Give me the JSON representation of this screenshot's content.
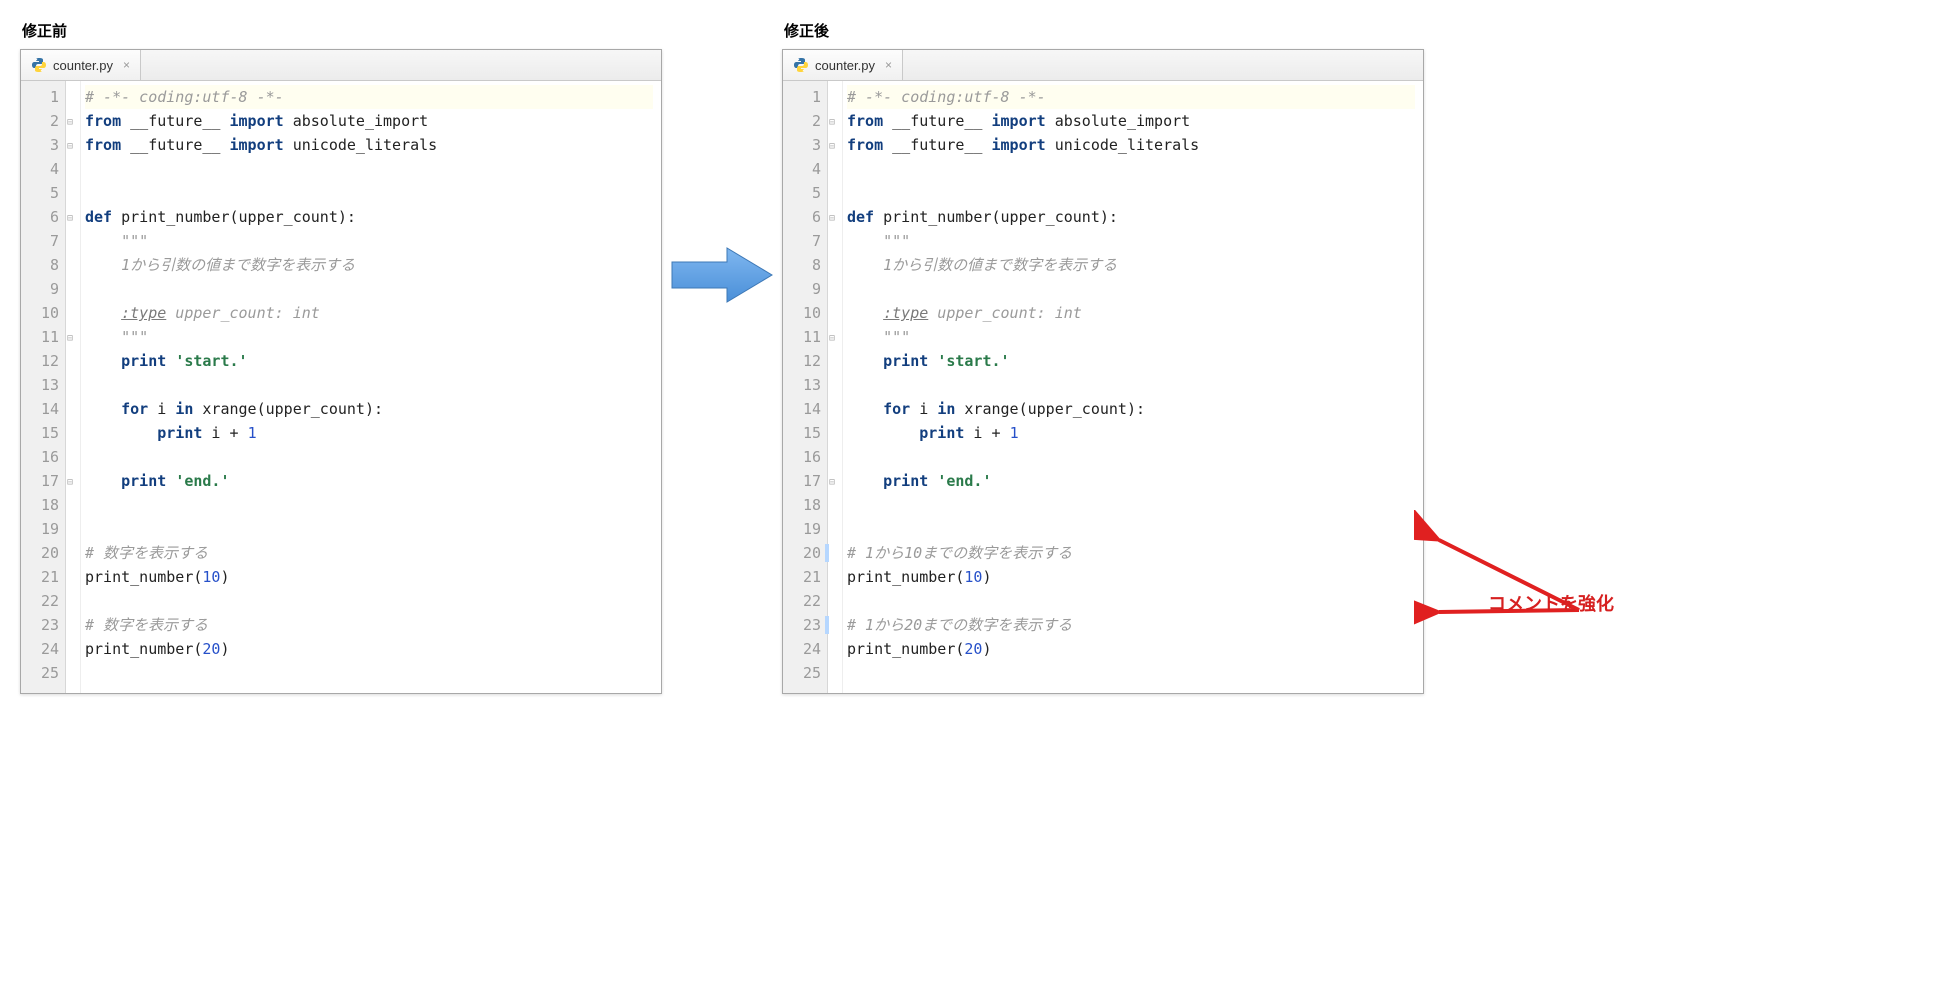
{
  "left": {
    "title": "修正前",
    "tab": {
      "filename": "counter.py"
    },
    "lines": [
      {
        "n": 1,
        "cls": "hl",
        "tokens": [
          [
            "c-comment",
            "# -*- coding:utf-8 -*-"
          ]
        ]
      },
      {
        "n": 2,
        "fold": true,
        "tokens": [
          [
            "c-kw",
            "from"
          ],
          [
            "c-plain",
            " __future__ "
          ],
          [
            "c-kw",
            "import"
          ],
          [
            "c-plain",
            " absolute_import"
          ]
        ]
      },
      {
        "n": 3,
        "fold": true,
        "tokens": [
          [
            "c-kw",
            "from"
          ],
          [
            "c-plain",
            " __future__ "
          ],
          [
            "c-kw",
            "import"
          ],
          [
            "c-plain",
            " unicode_literals"
          ]
        ]
      },
      {
        "n": 4,
        "tokens": []
      },
      {
        "n": 5,
        "tokens": []
      },
      {
        "n": 6,
        "fold": true,
        "tokens": [
          [
            "c-kw",
            "def"
          ],
          [
            "c-plain",
            " "
          ],
          [
            "c-fn",
            "print_number"
          ],
          [
            "c-plain",
            "(upper_count):"
          ]
        ]
      },
      {
        "n": 7,
        "tokens": [
          [
            "c-plain",
            "    "
          ],
          [
            "c-doc",
            "\"\"\""
          ]
        ]
      },
      {
        "n": 8,
        "tokens": [
          [
            "c-plain",
            "    "
          ],
          [
            "c-doc",
            "1から引数の値まで数字を表示する"
          ]
        ]
      },
      {
        "n": 9,
        "tokens": []
      },
      {
        "n": 10,
        "tokens": [
          [
            "c-plain",
            "    "
          ],
          [
            "c-doctag",
            ":type"
          ],
          [
            "c-doc",
            " upper_count: int"
          ]
        ]
      },
      {
        "n": 11,
        "fold": true,
        "tokens": [
          [
            "c-plain",
            "    "
          ],
          [
            "c-doc",
            "\"\"\""
          ]
        ]
      },
      {
        "n": 12,
        "tokens": [
          [
            "c-plain",
            "    "
          ],
          [
            "c-kw",
            "print"
          ],
          [
            "c-plain",
            " "
          ],
          [
            "c-str",
            "'start.'"
          ]
        ]
      },
      {
        "n": 13,
        "tokens": []
      },
      {
        "n": 14,
        "tokens": [
          [
            "c-plain",
            "    "
          ],
          [
            "c-kw",
            "for"
          ],
          [
            "c-plain",
            " i "
          ],
          [
            "c-kw",
            "in"
          ],
          [
            "c-plain",
            " xrange(upper_count):"
          ]
        ]
      },
      {
        "n": 15,
        "tokens": [
          [
            "c-plain",
            "        "
          ],
          [
            "c-kw",
            "print"
          ],
          [
            "c-plain",
            " i "
          ],
          [
            "c-op",
            "+"
          ],
          [
            "c-plain",
            " "
          ],
          [
            "c-num",
            "1"
          ]
        ]
      },
      {
        "n": 16,
        "tokens": []
      },
      {
        "n": 17,
        "fold": true,
        "tokens": [
          [
            "c-plain",
            "    "
          ],
          [
            "c-kw",
            "print"
          ],
          [
            "c-plain",
            " "
          ],
          [
            "c-str",
            "'end.'"
          ]
        ]
      },
      {
        "n": 18,
        "tokens": []
      },
      {
        "n": 19,
        "tokens": []
      },
      {
        "n": 20,
        "tokens": [
          [
            "c-comment",
            "# 数字を表示する"
          ]
        ]
      },
      {
        "n": 21,
        "tokens": [
          [
            "c-plain",
            "print_number("
          ],
          [
            "c-num",
            "10"
          ],
          [
            "c-plain",
            ")"
          ]
        ]
      },
      {
        "n": 22,
        "tokens": []
      },
      {
        "n": 23,
        "tokens": [
          [
            "c-comment",
            "# 数字を表示する"
          ]
        ]
      },
      {
        "n": 24,
        "tokens": [
          [
            "c-plain",
            "print_number("
          ],
          [
            "c-num",
            "20"
          ],
          [
            "c-plain",
            ")"
          ]
        ]
      },
      {
        "n": 25,
        "tokens": []
      }
    ]
  },
  "right": {
    "title": "修正後",
    "tab": {
      "filename": "counter.py"
    },
    "lines": [
      {
        "n": 1,
        "cls": "hl",
        "tokens": [
          [
            "c-comment",
            "# -*- coding:utf-8 -*-"
          ]
        ]
      },
      {
        "n": 2,
        "fold": true,
        "tokens": [
          [
            "c-kw",
            "from"
          ],
          [
            "c-plain",
            " __future__ "
          ],
          [
            "c-kw",
            "import"
          ],
          [
            "c-plain",
            " absolute_import"
          ]
        ]
      },
      {
        "n": 3,
        "fold": true,
        "tokens": [
          [
            "c-kw",
            "from"
          ],
          [
            "c-plain",
            " __future__ "
          ],
          [
            "c-kw",
            "import"
          ],
          [
            "c-plain",
            " unicode_literals"
          ]
        ]
      },
      {
        "n": 4,
        "tokens": []
      },
      {
        "n": 5,
        "tokens": []
      },
      {
        "n": 6,
        "fold": true,
        "tokens": [
          [
            "c-kw",
            "def"
          ],
          [
            "c-plain",
            " "
          ],
          [
            "c-fn",
            "print_number"
          ],
          [
            "c-plain",
            "(upper_count):"
          ]
        ]
      },
      {
        "n": 7,
        "tokens": [
          [
            "c-plain",
            "    "
          ],
          [
            "c-doc",
            "\"\"\""
          ]
        ]
      },
      {
        "n": 8,
        "tokens": [
          [
            "c-plain",
            "    "
          ],
          [
            "c-doc",
            "1から引数の値まで数字を表示する"
          ]
        ]
      },
      {
        "n": 9,
        "tokens": []
      },
      {
        "n": 10,
        "tokens": [
          [
            "c-plain",
            "    "
          ],
          [
            "c-doctag",
            ":type"
          ],
          [
            "c-doc",
            " upper_count: int"
          ]
        ]
      },
      {
        "n": 11,
        "fold": true,
        "tokens": [
          [
            "c-plain",
            "    "
          ],
          [
            "c-doc",
            "\"\"\""
          ]
        ]
      },
      {
        "n": 12,
        "tokens": [
          [
            "c-plain",
            "    "
          ],
          [
            "c-kw",
            "print"
          ],
          [
            "c-plain",
            " "
          ],
          [
            "c-str",
            "'start.'"
          ]
        ]
      },
      {
        "n": 13,
        "tokens": []
      },
      {
        "n": 14,
        "tokens": [
          [
            "c-plain",
            "    "
          ],
          [
            "c-kw",
            "for"
          ],
          [
            "c-plain",
            " i "
          ],
          [
            "c-kw",
            "in"
          ],
          [
            "c-plain",
            " xrange(upper_count):"
          ]
        ]
      },
      {
        "n": 15,
        "tokens": [
          [
            "c-plain",
            "        "
          ],
          [
            "c-kw",
            "print"
          ],
          [
            "c-plain",
            " i "
          ],
          [
            "c-op",
            "+"
          ],
          [
            "c-plain",
            " "
          ],
          [
            "c-num",
            "1"
          ]
        ]
      },
      {
        "n": 16,
        "tokens": []
      },
      {
        "n": 17,
        "fold": true,
        "tokens": [
          [
            "c-plain",
            "    "
          ],
          [
            "c-kw",
            "print"
          ],
          [
            "c-plain",
            " "
          ],
          [
            "c-str",
            "'end.'"
          ]
        ]
      },
      {
        "n": 18,
        "tokens": []
      },
      {
        "n": 19,
        "tokens": []
      },
      {
        "n": 20,
        "mod": true,
        "tokens": [
          [
            "c-comment",
            "# 1から10までの数字を表示する"
          ]
        ]
      },
      {
        "n": 21,
        "tokens": [
          [
            "c-plain",
            "print_number("
          ],
          [
            "c-num",
            "10"
          ],
          [
            "c-plain",
            ")"
          ]
        ]
      },
      {
        "n": 22,
        "tokens": []
      },
      {
        "n": 23,
        "mod": true,
        "tokens": [
          [
            "c-comment",
            "# 1から20までの数字を表示する"
          ]
        ]
      },
      {
        "n": 24,
        "tokens": [
          [
            "c-plain",
            "print_number("
          ],
          [
            "c-num",
            "20"
          ],
          [
            "c-plain",
            ")"
          ]
        ]
      },
      {
        "n": 25,
        "tokens": []
      }
    ]
  },
  "annotation": {
    "label": "コメントを強化"
  }
}
